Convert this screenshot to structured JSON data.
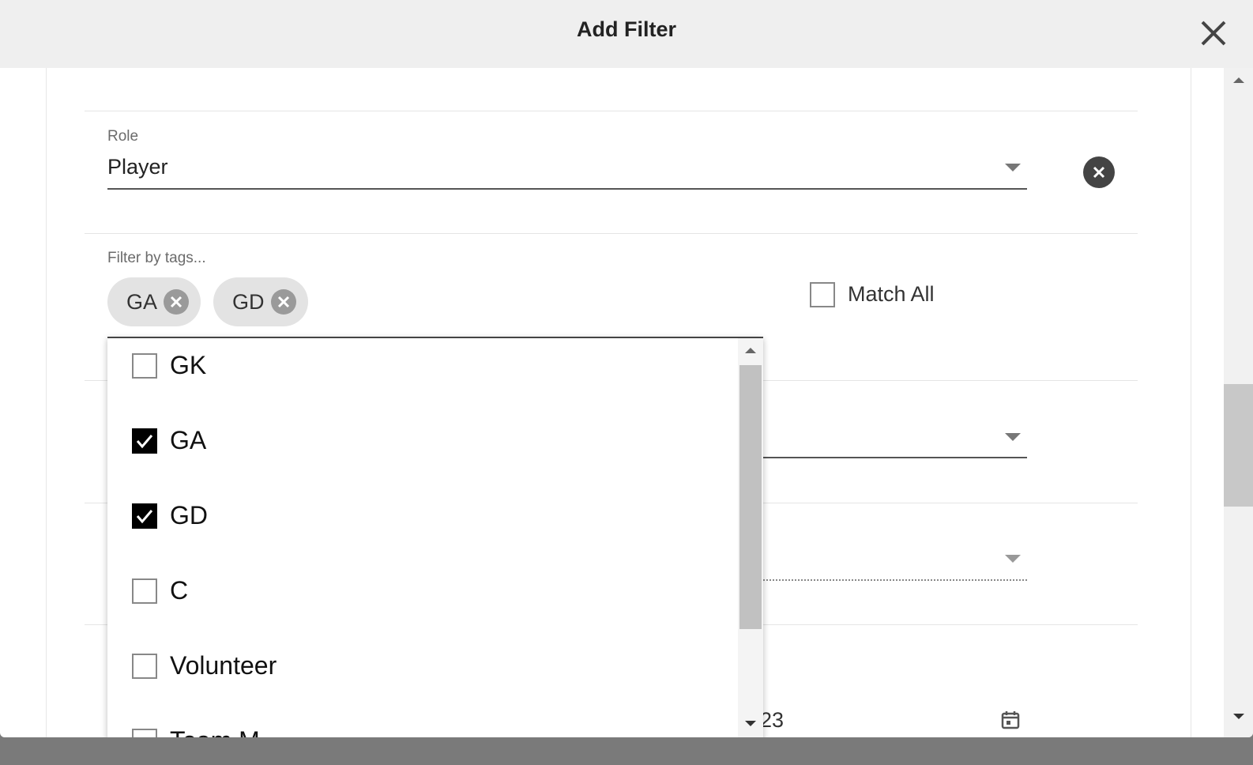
{
  "modal": {
    "title": "Add Filter"
  },
  "role_filter": {
    "label": "Role",
    "value": "Player"
  },
  "tags_filter": {
    "label": "Filter by tags...",
    "chips": [
      {
        "label": "GA"
      },
      {
        "label": "GD"
      }
    ],
    "match_all": {
      "label": "Match All",
      "checked": false
    }
  },
  "tags_dropdown": {
    "options": [
      {
        "label": "GK",
        "checked": false
      },
      {
        "label": "GA",
        "checked": true
      },
      {
        "label": "GD",
        "checked": true
      },
      {
        "label": "C",
        "checked": false
      },
      {
        "label": "Volunteer",
        "checked": false
      },
      {
        "label": "Team M",
        "checked": false
      }
    ]
  },
  "date_filter": {
    "value_partial": "23"
  },
  "icons": {
    "close": "close-icon",
    "clear": "clear-circle-icon",
    "chip_remove": "remove-chip-icon",
    "dropdown": "chevron-down-icon",
    "calendar": "calendar-icon",
    "check": "checkmark-icon"
  },
  "colors": {
    "header_bg": "#efefef",
    "chip_bg": "#e3e3e3",
    "checked_fill": "#000000",
    "clear_button": "#444444"
  }
}
